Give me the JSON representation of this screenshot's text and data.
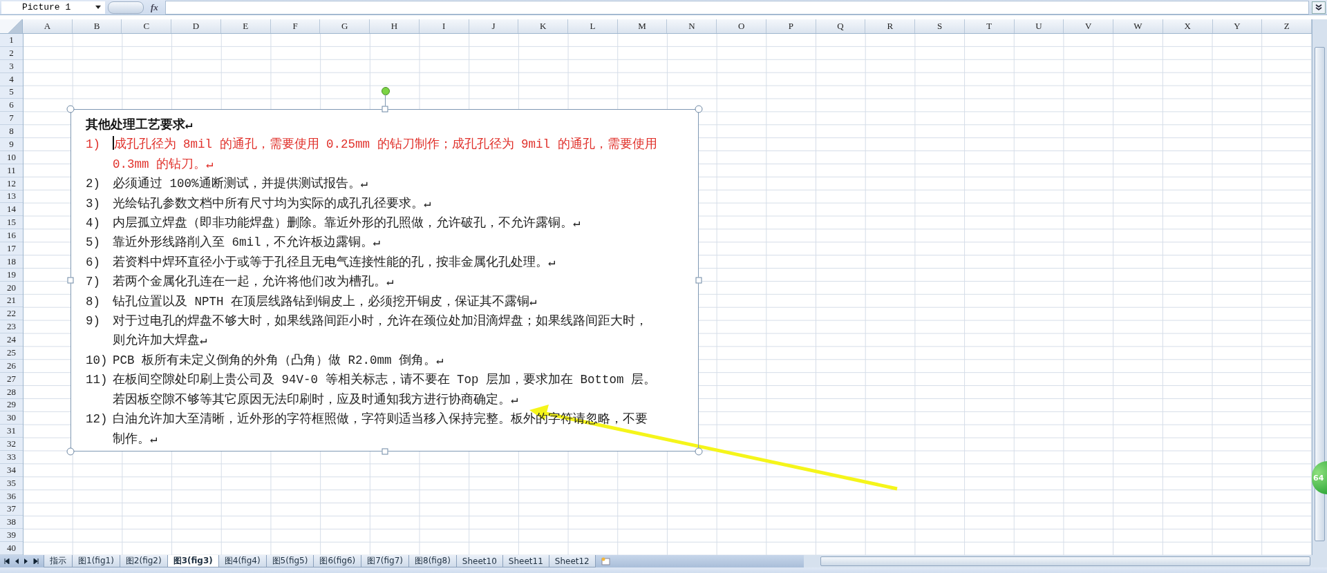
{
  "name_box": {
    "value": "Picture 1"
  },
  "formula_bar": {
    "fx_label": "fx"
  },
  "columns": [
    "A",
    "B",
    "C",
    "D",
    "E",
    "F",
    "G",
    "H",
    "I",
    "J",
    "K",
    "L",
    "M",
    "N",
    "O",
    "P",
    "Q",
    "R",
    "S",
    "T",
    "U",
    "V",
    "W",
    "X",
    "Y",
    "Z"
  ],
  "rows": [
    "1",
    "2",
    "3",
    "4",
    "5",
    "6",
    "7",
    "8",
    "9",
    "10",
    "11",
    "12",
    "13",
    "14",
    "15",
    "16",
    "17",
    "18",
    "19",
    "20",
    "21",
    "22",
    "23",
    "24",
    "25",
    "26",
    "27",
    "28",
    "29",
    "30",
    "31",
    "32",
    "33",
    "34",
    "35",
    "36",
    "37",
    "38",
    "39",
    "40"
  ],
  "text_box": {
    "title": "其他处理工艺要求↵",
    "items": [
      {
        "number": "1)",
        "text": "成孔孔径为 8mil 的通孔，需要使用 0.25mm 的钻刀制作；成孔孔径为 9mil 的通孔，需要使用 0.3mm 的钻刀。↵",
        "color": "#e0302a",
        "cursor": true
      },
      {
        "number": "2)",
        "text": "必须通过 100%通断测试，并提供测试报告。↵",
        "color": "#222222",
        "cursor": false
      },
      {
        "number": "3)",
        "text": "光绘钻孔参数文档中所有尺寸均为实际的成孔孔径要求。↵",
        "color": "#222222",
        "cursor": false
      },
      {
        "number": "4)",
        "text": "内层孤立焊盘（即非功能焊盘）删除。靠近外形的孔照做，允许破孔，不允许露铜。↵",
        "color": "#222222",
        "cursor": false
      },
      {
        "number": "5)",
        "text": "靠近外形线路削入至 6mil，不允许板边露铜。↵",
        "color": "#222222",
        "cursor": false
      },
      {
        "number": "6)",
        "text": "若资料中焊环直径小于或等于孔径且无电气连接性能的孔，按非金属化孔处理。↵",
        "color": "#222222",
        "cursor": false
      },
      {
        "number": "7)",
        "text": "若两个金属化孔连在一起，允许将他们改为槽孔。↵",
        "color": "#222222",
        "cursor": false
      },
      {
        "number": "8)",
        "text": "钻孔位置以及 NPTH 在顶层线路钻到铜皮上，必须挖开铜皮，保证其不露铜↵",
        "color": "#222222",
        "cursor": false
      },
      {
        "number": "9)",
        "text": "对于过电孔的焊盘不够大时，如果线路间距小时，允许在颈位处加泪滴焊盘；如果线路间距大时，则允许加大焊盘↵",
        "color": "#222222",
        "cursor": false
      },
      {
        "number": "10)",
        "text": "PCB 板所有未定义倒角的外角（凸角）做 R2.0mm 倒角。↵",
        "color": "#222222",
        "cursor": false
      },
      {
        "number": "11)",
        "text": "在板间空隙处印刷上贵公司及 94V-0 等相关标志，请不要在 Top 层加，要求加在 Bottom 层。若因板空隙不够等其它原因无法印刷时，应及时通知我方进行协商确定。↵",
        "color": "#222222",
        "cursor": false
      },
      {
        "number": "12)",
        "text": "白油允许加大至清晰，近外形的字符框照做，字符则适当移入保持完整。板外的字符请忽略，不要制作。↵",
        "color": "#222222",
        "cursor": false
      }
    ]
  },
  "sheet_tabs": [
    {
      "label": "指示",
      "selected": false
    },
    {
      "label": "图1(fig1)",
      "selected": false
    },
    {
      "label": "图2(fig2)",
      "selected": false
    },
    {
      "label": "图3(fig3)",
      "selected": true
    },
    {
      "label": "图4(fig4)",
      "selected": false
    },
    {
      "label": "图5(fig5)",
      "selected": false
    },
    {
      "label": "图6(fig6)",
      "selected": false
    },
    {
      "label": "图7(fig7)",
      "selected": false
    },
    {
      "label": "图8(fig8)",
      "selected": false
    },
    {
      "label": "Sheet10",
      "selected": false
    },
    {
      "label": "Sheet11",
      "selected": false
    },
    {
      "label": "Sheet12",
      "selected": false
    }
  ],
  "badge": {
    "text": "64"
  }
}
